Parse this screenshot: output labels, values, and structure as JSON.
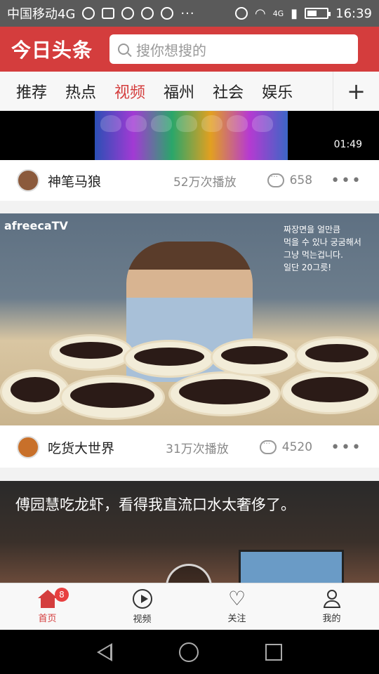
{
  "status": {
    "carrier": "中国移动4G",
    "network": "4G",
    "time": "16:39",
    "battery_level": 0.5
  },
  "header": {
    "logo": "今日头条",
    "search_placeholder": "搜你想搜的"
  },
  "tabs": [
    "推荐",
    "热点",
    "视频",
    "福州",
    "社会",
    "娱乐"
  ],
  "active_tab": "视频",
  "tabs_plus": "+",
  "feed": [
    {
      "duration": "01:49",
      "author": "神笔马狼",
      "plays": "52万次播放",
      "comments": "658"
    },
    {
      "brand": "afreecaTV",
      "caption": "짜장면을 얼만큼\n먹을 수 있나 궁굼해서\n그냥 먹는겁니다.\n일단 20그릇!",
      "author": "吃货大世界",
      "plays": "31万次播放",
      "comments": "4520"
    },
    {
      "title": "傅园慧吃龙虾，看得我直流口水太奢侈了。"
    }
  ],
  "bottom_nav": [
    {
      "label": "首页",
      "icon": "home-icon",
      "badge": "8"
    },
    {
      "label": "视频",
      "icon": "play-icon"
    },
    {
      "label": "关注",
      "icon": "heart-icon"
    },
    {
      "label": "我的",
      "icon": "user-icon"
    }
  ],
  "colors": {
    "accent": "#d43d3d"
  }
}
